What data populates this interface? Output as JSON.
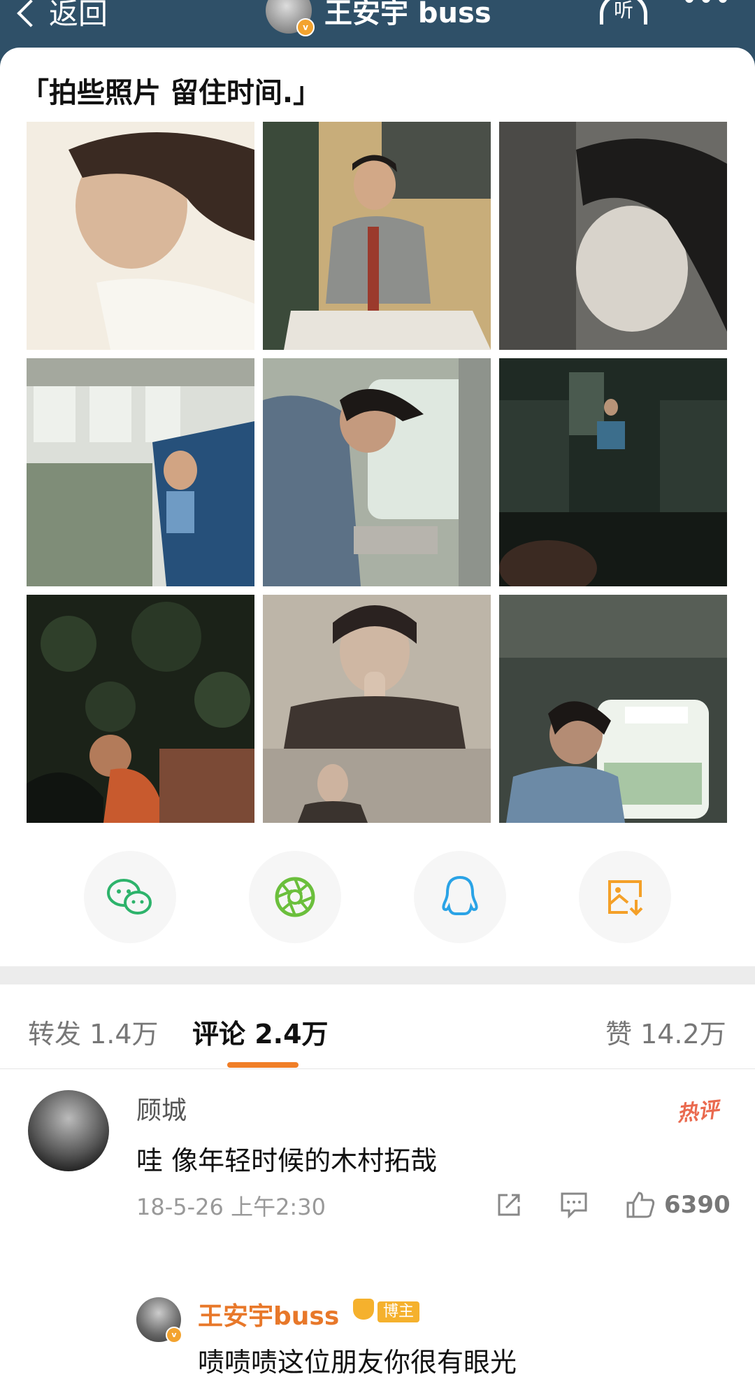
{
  "nav": {
    "back_label": "返回",
    "user_name": "王安宇 buss",
    "listen_label": "听"
  },
  "post": {
    "text": "「拍些照片 留住时间.」",
    "photos": [
      {
        "desc": "portrait-profile-window"
      },
      {
        "desc": "sitting-by-train-door"
      },
      {
        "desc": "closeup-face-monochrome"
      },
      {
        "desc": "train-carriage-seats"
      },
      {
        "desc": "leaning-at-train-sink"
      },
      {
        "desc": "dark-train-interior"
      },
      {
        "desc": "night-foliage-crouch"
      },
      {
        "desc": "hands-clasped-sepia"
      },
      {
        "desc": "gazing-out-train-window"
      }
    ]
  },
  "share": {
    "buttons": [
      {
        "icon": "wechat-icon",
        "color": "#2db36b"
      },
      {
        "icon": "moments-icon",
        "color": "#6bbf3c"
      },
      {
        "icon": "qq-icon",
        "color": "#2aa3e6"
      },
      {
        "icon": "save-image-icon",
        "color": "#f4a028"
      }
    ]
  },
  "tabs": {
    "repost": "转发 1.4万",
    "comments": "评论 2.4万",
    "likes": "赞 14.2万"
  },
  "comment": {
    "user": "顾城",
    "hot_label": "热评",
    "text": "哇 像年轻时候的木村拓哉",
    "time": "18-5-26 上午2:30",
    "like_count": "6390",
    "reply": {
      "user": "王安宇buss",
      "badge": "博主",
      "text": "啧啧啧这位朋友你很有眼光"
    }
  },
  "colors": {
    "nav_bg": "#2f5068",
    "accent": "#f07e27",
    "reply_name": "#e8782a"
  }
}
